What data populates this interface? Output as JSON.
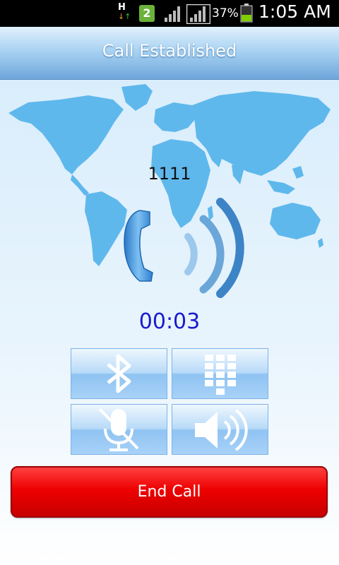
{
  "status_bar": {
    "network_type": "H",
    "notification_badge": "2",
    "battery_percent": "37%",
    "time": "1:05 AM",
    "icons": [
      "data-transfer-icon",
      "notification-badge-icon",
      "signal-icon",
      "signal-icon",
      "battery-icon"
    ]
  },
  "header": {
    "title": "Call Established"
  },
  "call": {
    "number": "1111",
    "duration": "00:03"
  },
  "controls": {
    "bluetooth": {
      "icon": "bluetooth-icon"
    },
    "keypad": {
      "icon": "dialpad-icon"
    },
    "mute": {
      "icon": "microphone-muted-icon"
    },
    "speaker": {
      "icon": "speaker-icon"
    }
  },
  "end_call": {
    "label": "End Call"
  },
  "colors": {
    "accent_blue": "#1a1acc",
    "map_blue": "#5fb8ec",
    "end_call_red": "#ee0000",
    "header_blue": "#6ea6da"
  }
}
